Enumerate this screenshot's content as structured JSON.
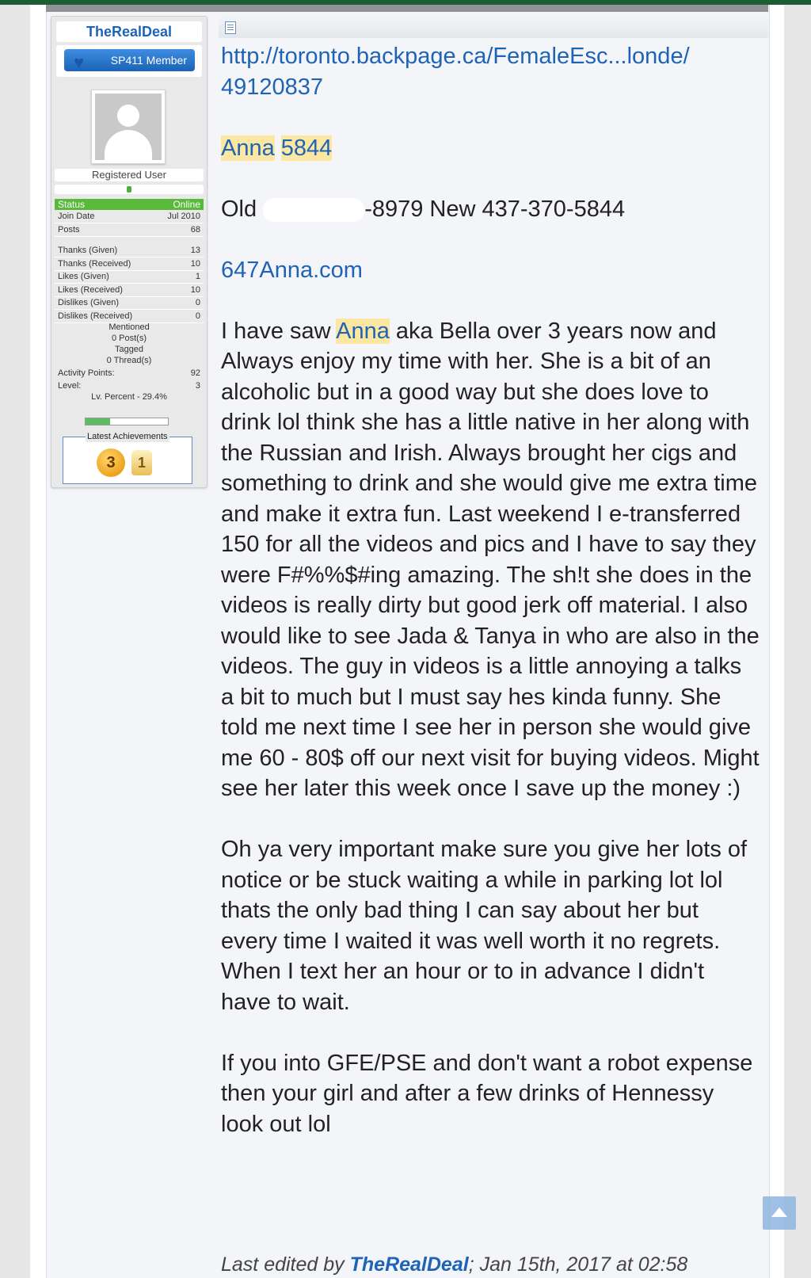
{
  "user": {
    "name": "TheRealDeal",
    "rank_badge": "SP411 Member",
    "title": "Registered User",
    "status_label": "Status",
    "status_value": "Online",
    "stats": [
      {
        "label": "Join Date",
        "value": "Jul 2010"
      },
      {
        "label": "Posts",
        "value": "68"
      },
      {
        "label": "Thanks (Given)",
        "value": "13"
      },
      {
        "label": "Thanks (Received)",
        "value": "10"
      },
      {
        "label": "Likes (Given)",
        "value": "1"
      },
      {
        "label": "Likes (Received)",
        "value": "10"
      },
      {
        "label": "Dislikes (Given)",
        "value": "0"
      },
      {
        "label": "Dislikes (Received)",
        "value": "0"
      }
    ],
    "mentioned_label": "Mentioned",
    "mentioned_value": "0 Post(s)",
    "tagged_label": "Tagged",
    "tagged_value": "0 Thread(s)",
    "activity_label": "Activity Points:",
    "activity_value": "92",
    "level_label": "Level:",
    "level_value": "3",
    "lv_percent_text": "Lv. Percent - 29.4%",
    "lv_percent": 29.4,
    "achievements_title": "Latest Achievements",
    "achievements": [
      "3",
      "1"
    ]
  },
  "post": {
    "url_line1": "http://toronto.backpage.ca/FemaleEsc...londe/",
    "url_line2": "49120837",
    "name_a": "Anna",
    "name_b": "5844",
    "phone_old_label": "Old",
    "phone_old_tail": "-8979 New 437-370-5844",
    "site": "647Anna.com",
    "para1_pre": "I have saw",
    "para1_name": "Anna",
    "para1_rest": "aka Bella over 3 years now and Always enjoy my time with her. She is a bit of an alcoholic but in a good way but she does love to drink lol think she has a little native in her along with the Russian and Irish. Always brought her cigs and something to drink and she would give me extra time and make it extra fun. Last weekend I e-transferred 150 for all the videos and pics and I have to say they were F#%%$#ing amazing. The sh!t she does in the videos is really dirty but good jerk off material. I also would like to see Jada & Tanya in who are also in the videos. The guy in videos is a little annoying a talks a bit to much but I must say hes kinda funny. She told me next time I see her in person she would give me 60 - 80$ off our next visit for buying videos. Might see her later this week once I save up the money :)",
    "para2": "Oh ya very important make sure you give her lots of notice or be stuck waiting a while in parking lot lol thats the only bad thing I can say about her but every time I waited it was well worth it no regrets. When I text her an hour or to in advance I didn't have to wait.",
    "para3": "If you into GFE/PSE and don't want a robot expense then your girl and after a few drinks of Hennessy look out lol",
    "edit_prefix": "Last edited by",
    "edit_author": "TheRealDeal",
    "edit_suffix": "; Jan 15th, 2017 at 02:58"
  },
  "colors": {
    "link": "#1f63b5",
    "highlight": "#fbe7a1",
    "status_bar": "#59b93a",
    "top_bar": "#1b5e34"
  }
}
